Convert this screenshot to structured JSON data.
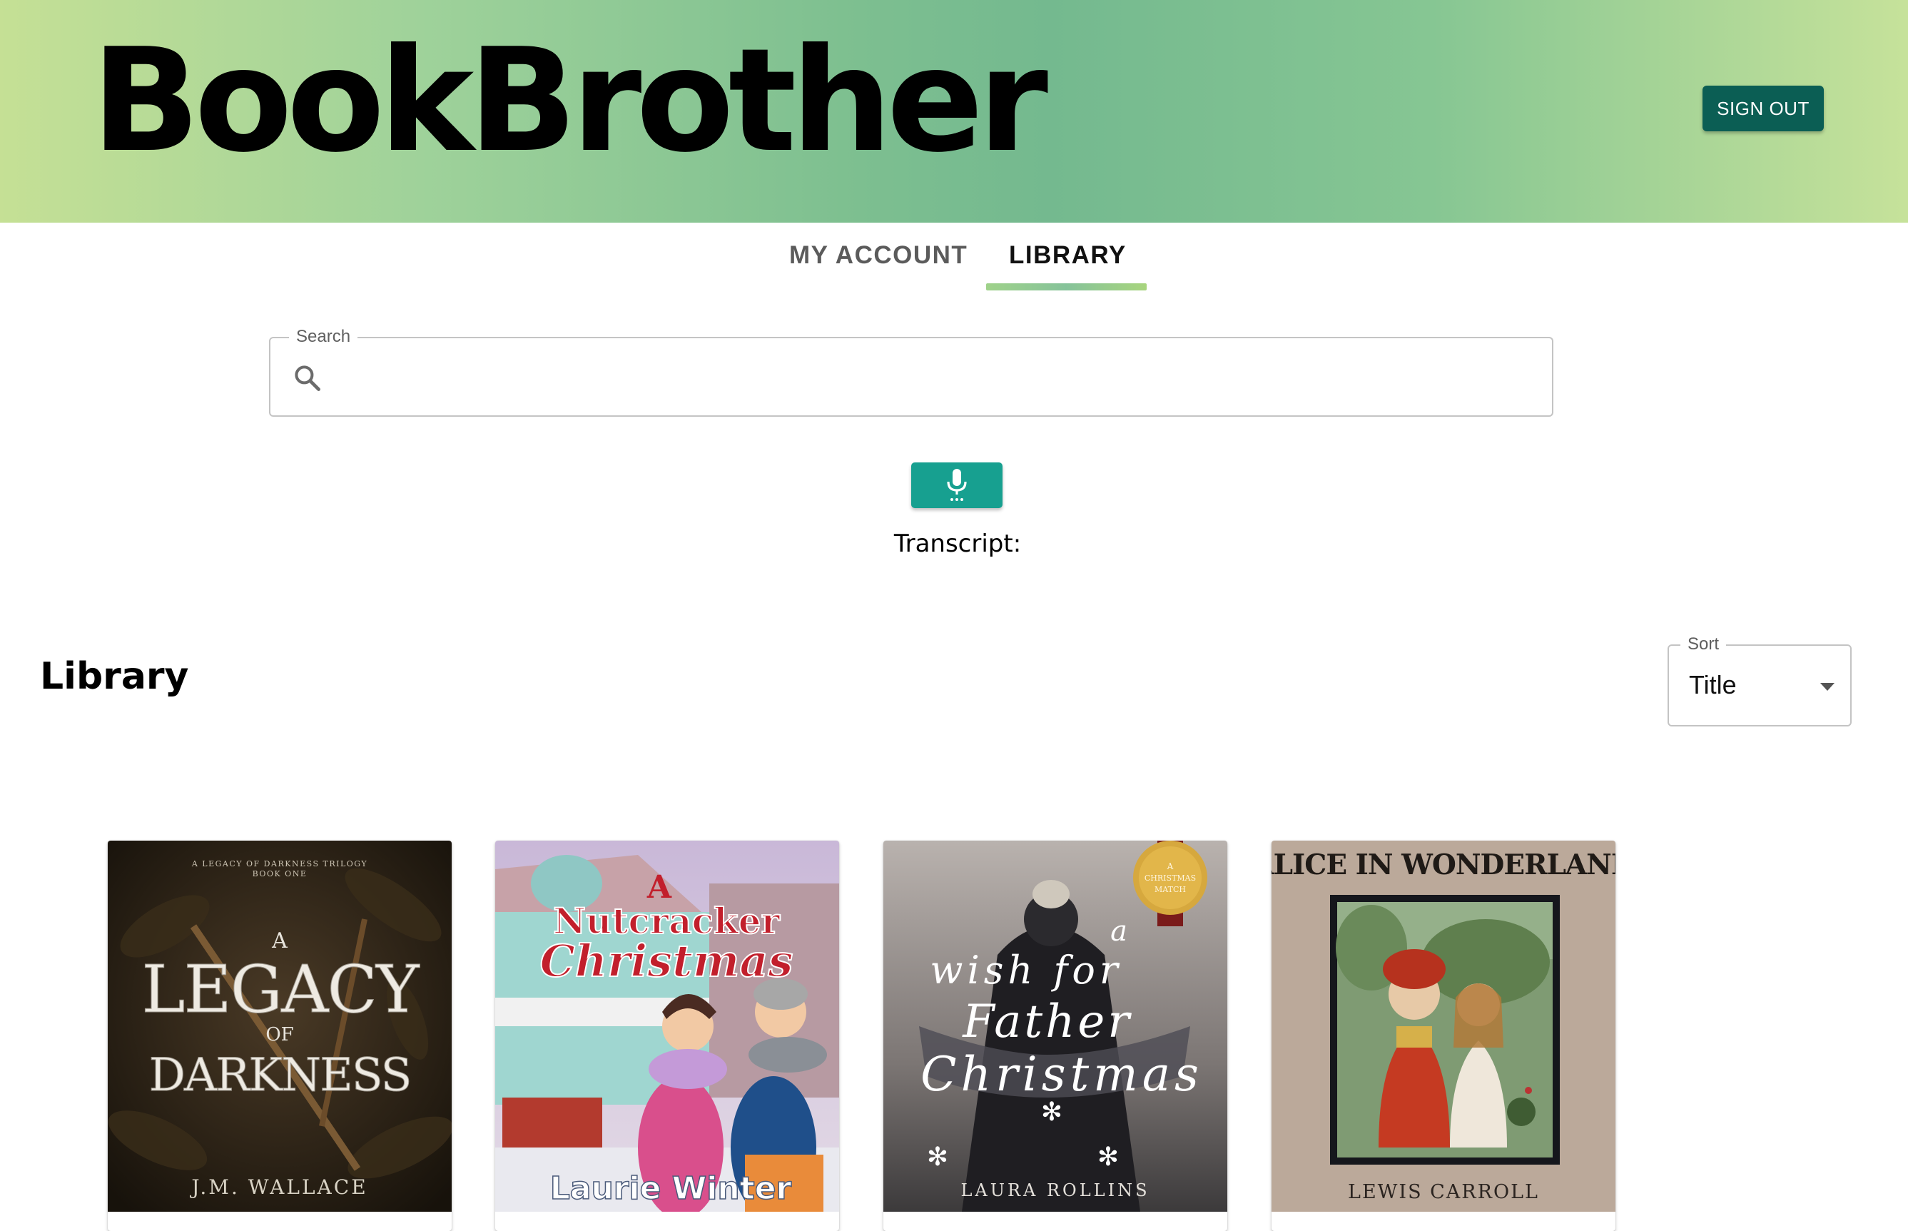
{
  "header": {
    "brand": "BookBrother",
    "signout_label": "SIGN OUT"
  },
  "tabs": [
    {
      "label": "MY ACCOUNT",
      "active": false
    },
    {
      "label": "LIBRARY",
      "active": true
    }
  ],
  "search": {
    "legend": "Search",
    "value": "",
    "icon": "search-icon"
  },
  "voice": {
    "icon": "microphone-icon",
    "transcript_label": "Transcript:"
  },
  "library": {
    "title": "Library",
    "sort": {
      "legend": "Sort",
      "selected": "Title"
    }
  },
  "books": [
    {
      "series_line1": "A LEGACY OF DARKNESS TRILOGY",
      "series_line2": "BOOK ONE",
      "title_a": "A",
      "title_b": "LEGACY",
      "title_c": "OF",
      "title_d": "DARKNESS",
      "author": "J.M. WALLACE"
    },
    {
      "title_a": "A",
      "title_b": "Nutcracker",
      "title_c": "Christmas",
      "author": "Laurie Winter"
    },
    {
      "badge_line1": "A",
      "badge_line2": "CHRISTMAS",
      "badge_line3": "MATCH",
      "title_a": "a",
      "title_b": "wish for",
      "title_c": "Father",
      "title_d": "Christmas",
      "author": "LAURA ROLLINS"
    },
    {
      "title": "ALICE IN WONDERLAND",
      "author": "LEWIS CARROLL"
    }
  ],
  "colors": {
    "signout_bg": "#0b5e54",
    "mic_bg": "#17a090",
    "tab_indicator": "#9fd28a"
  }
}
